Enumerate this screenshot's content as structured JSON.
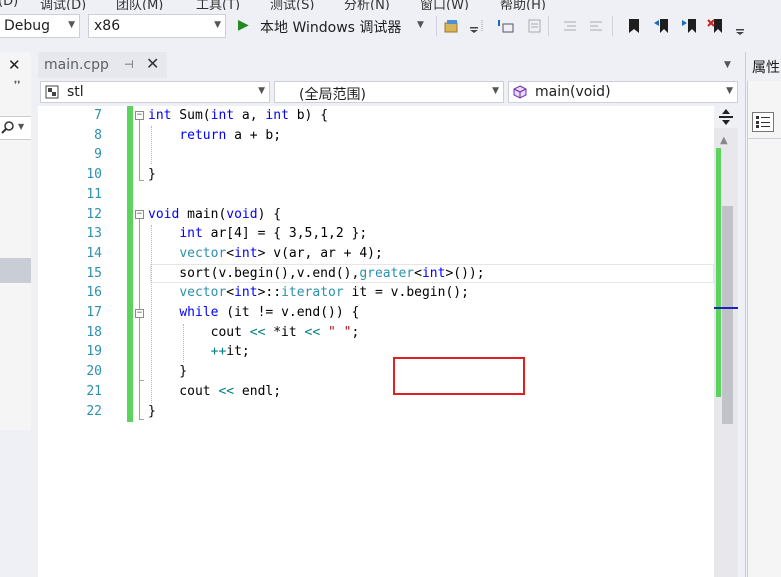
{
  "menu": {
    "items": [
      "(D)",
      "调试(D)",
      "团队(M)",
      "工具(T)",
      "测试(S)",
      "分析(N)",
      "窗口(W)",
      "帮助(H)"
    ]
  },
  "toolbar": {
    "config_value": "Debug",
    "platform_value": "x86",
    "run_label": "本地 Windows 调试器",
    "icons": [
      "play-icon",
      "folder-icon",
      "step-icon",
      "indent-icon",
      "comment-icon",
      "bookmark-icon"
    ]
  },
  "left_panel": {
    "close_glyph": "✕",
    "pin_glyph": "❜❜",
    "search_glyph": "⚲"
  },
  "tab": {
    "filename": "main.cpp",
    "pin_glyph": "⊣",
    "close_glyph": "✕"
  },
  "nav": {
    "project": "stl",
    "scope": "(全局范围)",
    "member": "main(void)"
  },
  "editor": {
    "line_numbers": [
      "7",
      "8",
      "9",
      "10",
      "11",
      "12",
      "13",
      "14",
      "15",
      "16",
      "17",
      "18",
      "19",
      "20",
      "21",
      "22"
    ],
    "lines": [
      [
        {
          "t": "int",
          "c": "kw"
        },
        {
          "t": " Sum("
        },
        {
          "t": "int",
          "c": "kw"
        },
        {
          "t": " a, "
        },
        {
          "t": "int",
          "c": "kw"
        },
        {
          "t": " b) {"
        }
      ],
      [
        {
          "t": "    "
        },
        {
          "t": "return",
          "c": "kw"
        },
        {
          "t": " a + b;"
        }
      ],
      [
        {
          "t": ""
        }
      ],
      [
        {
          "t": "}"
        }
      ],
      [
        {
          "t": ""
        }
      ],
      [
        {
          "t": "void",
          "c": "kw"
        },
        {
          "t": " main("
        },
        {
          "t": "void",
          "c": "kw"
        },
        {
          "t": ") {"
        }
      ],
      [
        {
          "t": "    "
        },
        {
          "t": "int",
          "c": "kw"
        },
        {
          "t": " ar[4] = { 3,5,1,2 };"
        }
      ],
      [
        {
          "t": "    "
        },
        {
          "t": "vector",
          "c": "ty"
        },
        {
          "t": "<"
        },
        {
          "t": "int",
          "c": "kw"
        },
        {
          "t": "> v(ar, ar + 4);"
        }
      ],
      [
        {
          "t": "    sort(v.begin(),v.end(),"
        },
        {
          "t": "greater",
          "c": "ty"
        },
        {
          "t": "<"
        },
        {
          "t": "int",
          "c": "kw"
        },
        {
          "t": ">());"
        }
      ],
      [
        {
          "t": "    "
        },
        {
          "t": "vector",
          "c": "ty"
        },
        {
          "t": "<"
        },
        {
          "t": "int",
          "c": "kw"
        },
        {
          "t": ">::"
        },
        {
          "t": "iterator",
          "c": "ty"
        },
        {
          "t": " it = v.begin();"
        }
      ],
      [
        {
          "t": "    "
        },
        {
          "t": "while",
          "c": "kw"
        },
        {
          "t": " (it != v.end()) {"
        }
      ],
      [
        {
          "t": "        cout "
        },
        {
          "t": "<<",
          "c": "op"
        },
        {
          "t": " *it "
        },
        {
          "t": "<<",
          "c": "op"
        },
        {
          "t": " "
        },
        {
          "t": "\" \"",
          "c": "str"
        },
        {
          "t": ";"
        }
      ],
      [
        {
          "t": "        "
        },
        {
          "t": "++",
          "c": "op"
        },
        {
          "t": "it;"
        }
      ],
      [
        {
          "t": "    }"
        }
      ],
      [
        {
          "t": "    cout "
        },
        {
          "t": "<<",
          "c": "op"
        },
        {
          "t": " endl;"
        }
      ],
      [
        {
          "t": "}"
        }
      ]
    ]
  },
  "right_panel": {
    "title": "属性"
  }
}
